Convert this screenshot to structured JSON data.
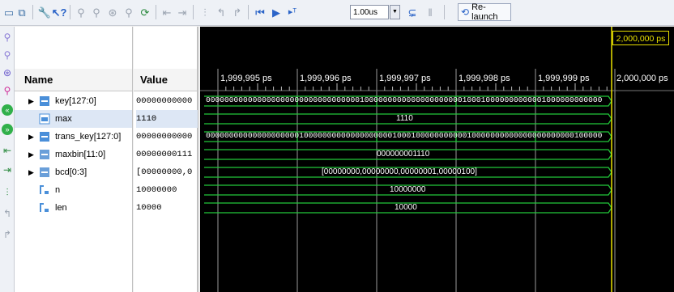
{
  "toolbar": {
    "zoom_value": "1.00us",
    "relaunch_label": "Re-launch"
  },
  "columns": {
    "name_header": "Name",
    "value_header": "Value"
  },
  "signals": [
    {
      "name": "key[127:0]",
      "value": "00000000000",
      "bus": true,
      "wave": "00000000000000000000000000000000010000000000000000000001000100000000000010000000000000000000..."
    },
    {
      "name": "max",
      "value": "1110",
      "bus": false,
      "wave": "1110"
    },
    {
      "name": "trans_key[127:0]",
      "value": "00000000000",
      "bus": true,
      "wave": "000000000000000000001000000000000000000010001000000000001000000000000000000000010000000..."
    },
    {
      "name": "maxbin[11:0]",
      "value": "00000000111",
      "bus": true,
      "wave": "000000001110"
    },
    {
      "name": "bcd[0:3]",
      "value": "[00000000,0",
      "bus": true,
      "wave": "[00000000,00000000,00000001,00000100]"
    },
    {
      "name": "n",
      "value": "10000000",
      "bus": false,
      "wave": "10000000"
    },
    {
      "name": "len",
      "value": "10000",
      "bus": false,
      "wave": "10000"
    }
  ],
  "timeline": {
    "cursor_label": "2,000,000 ps",
    "ticks": [
      "1,999,995 ps",
      "1,999,996 ps",
      "1,999,997 ps",
      "1,999,998 ps",
      "1,999,999 ps",
      "2,000,000 ps"
    ]
  },
  "icons": [
    "window-icon",
    "restore-icon",
    "wrench-icon",
    "help-cursor-icon",
    "zoom-in-icon",
    "zoom-out-icon",
    "zoom-full-icon",
    "zoom-cursor-icon",
    "refresh-icon",
    "goto-start-icon",
    "goto-end-icon",
    "add-marker-icon",
    "prev-transition-icon",
    "next-transition-icon",
    "restart-icon",
    "run-icon",
    "run-for-icon",
    "step-icon",
    "break-icon",
    "relaunch-icon"
  ],
  "colors": {
    "wave": "#22c83a",
    "cursor": "#e8e000",
    "background": "#000000"
  }
}
